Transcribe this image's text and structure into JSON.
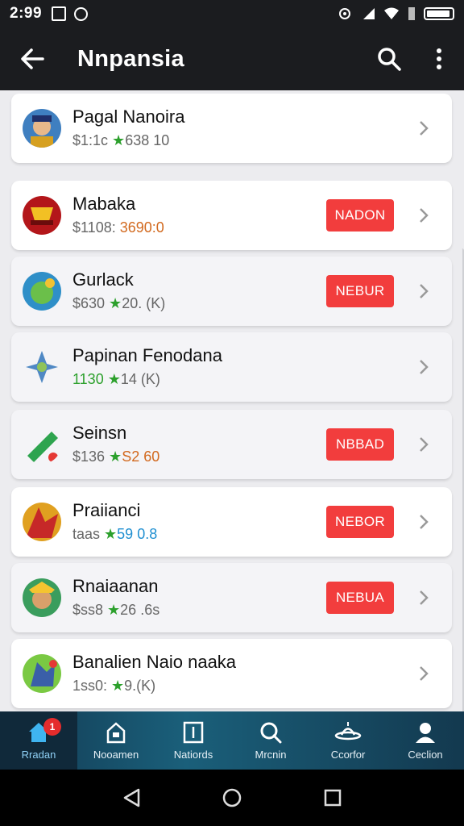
{
  "status_bar": {
    "time": "2:99"
  },
  "app_bar": {
    "title": "Nnpansia"
  },
  "apps": [
    {
      "name": "Pagal Nanoira",
      "meta_prefix": "$1:1c ",
      "meta_value": "638 10",
      "badge": ""
    },
    {
      "name": "Mabaka",
      "meta_prefix": "$1108: ",
      "meta_value": "3690:0",
      "badge": "NADON"
    },
    {
      "name": "Gurlack",
      "meta_prefix": "$630 ",
      "meta_value": "20. (K)",
      "badge": "NEBUR"
    },
    {
      "name": "Papinan Fenodana",
      "meta_prefix": "1130 ",
      "meta_value": "14 (K)",
      "badge": ""
    },
    {
      "name": "Seinsn",
      "meta_prefix": "$136 ",
      "meta_value": "S2  60",
      "badge": "NBBAD"
    },
    {
      "name": "Praiianci",
      "meta_prefix": "taas ",
      "meta_value": "59 0.8",
      "badge": "NEBOR"
    },
    {
      "name": "Rnaiaanan",
      "meta_prefix": "$ss8 ",
      "meta_value": "26 .6s",
      "badge": "NEBUA"
    },
    {
      "name": "Banalien Naio naaka",
      "meta_prefix": "1ss0: ",
      "meta_value": "9.(K)",
      "badge": ""
    }
  ],
  "bottom_nav": [
    {
      "label": "Rradan",
      "badge": "1"
    },
    {
      "label": "Nooamen"
    },
    {
      "label": "Natiords"
    },
    {
      "label": "Mrcnin"
    },
    {
      "label": "Ccorfor"
    },
    {
      "label": "Ceclion"
    }
  ],
  "colors": {
    "badge": "#f23d3d",
    "star": "#2ca02c",
    "nav_active": "#8fd0f5"
  },
  "icons": [
    "back-arrow-icon",
    "search-icon",
    "more-vert-icon",
    "chevron-right-icon",
    "home-icon",
    "bag-icon",
    "document-icon",
    "search-icon",
    "hat-icon",
    "person-icon"
  ]
}
